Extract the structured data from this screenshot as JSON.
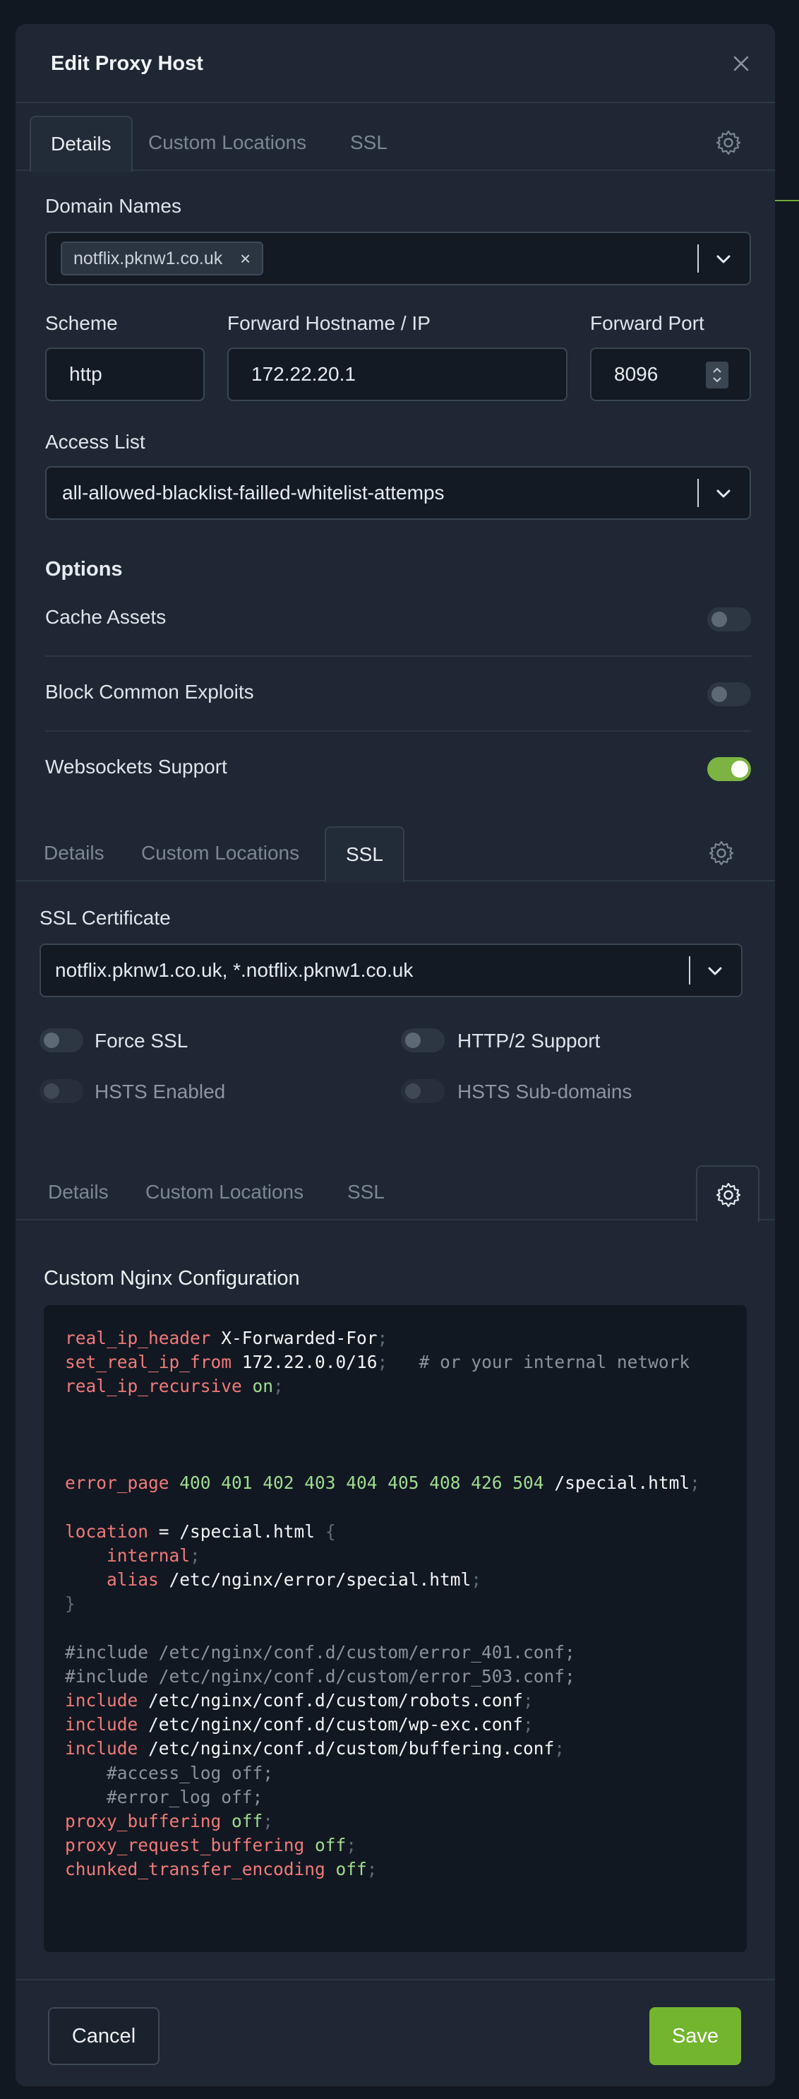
{
  "modal": {
    "title": "Edit Proxy Host"
  },
  "tabs": {
    "details": "Details",
    "custom_locations": "Custom Locations",
    "ssl": "SSL"
  },
  "details": {
    "domain_names_label": "Domain Names",
    "domain_chip": "notflix.pknw1.co.uk",
    "chip_remove": "×",
    "scheme_label": "Scheme",
    "scheme_value": "http",
    "forward_host_label": "Forward Hostname / IP",
    "forward_host_value": "172.22.20.1",
    "forward_port_label": "Forward Port",
    "forward_port_value": "8096",
    "access_list_label": "Access List",
    "access_list_value": "all-allowed-blacklist-failled-whitelist-attemps",
    "options_title": "Options",
    "options": [
      {
        "label": "Cache Assets",
        "on": false
      },
      {
        "label": "Block Common Exploits",
        "on": false
      },
      {
        "label": "Websockets Support",
        "on": true
      }
    ]
  },
  "ssl": {
    "certificate_label": "SSL Certificate",
    "certificate_value": "notflix.pknw1.co.uk, *.notflix.pknw1.co.uk",
    "force_ssl": "Force SSL",
    "http2": "HTTP/2 Support",
    "hsts": "HSTS Enabled",
    "hsts_sub": "HSTS Sub-domains"
  },
  "advanced": {
    "title": "Custom Nginx Configuration"
  },
  "footer": {
    "cancel": "Cancel",
    "save": "Save"
  },
  "colors": {
    "accent": "#74b52f",
    "background": "#1e2733",
    "keyword": "#ef7b79",
    "number": "#9fdc8f"
  }
}
